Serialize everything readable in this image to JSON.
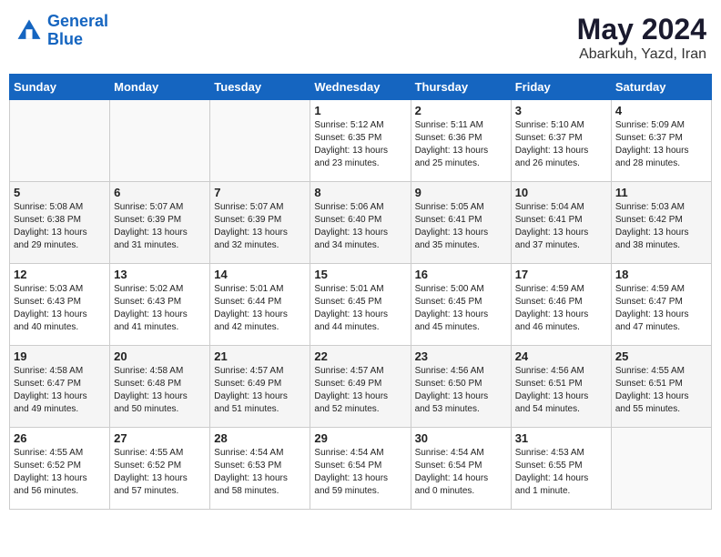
{
  "logo": {
    "line1": "General",
    "line2": "Blue"
  },
  "title": "May 2024",
  "subtitle": "Abarkuh, Yazd, Iran",
  "days_of_week": [
    "Sunday",
    "Monday",
    "Tuesday",
    "Wednesday",
    "Thursday",
    "Friday",
    "Saturday"
  ],
  "weeks": [
    [
      {
        "day": "",
        "info": ""
      },
      {
        "day": "",
        "info": ""
      },
      {
        "day": "",
        "info": ""
      },
      {
        "day": "1",
        "info": "Sunrise: 5:12 AM\nSunset: 6:35 PM\nDaylight: 13 hours\nand 23 minutes."
      },
      {
        "day": "2",
        "info": "Sunrise: 5:11 AM\nSunset: 6:36 PM\nDaylight: 13 hours\nand 25 minutes."
      },
      {
        "day": "3",
        "info": "Sunrise: 5:10 AM\nSunset: 6:37 PM\nDaylight: 13 hours\nand 26 minutes."
      },
      {
        "day": "4",
        "info": "Sunrise: 5:09 AM\nSunset: 6:37 PM\nDaylight: 13 hours\nand 28 minutes."
      }
    ],
    [
      {
        "day": "5",
        "info": "Sunrise: 5:08 AM\nSunset: 6:38 PM\nDaylight: 13 hours\nand 29 minutes."
      },
      {
        "day": "6",
        "info": "Sunrise: 5:07 AM\nSunset: 6:39 PM\nDaylight: 13 hours\nand 31 minutes."
      },
      {
        "day": "7",
        "info": "Sunrise: 5:07 AM\nSunset: 6:39 PM\nDaylight: 13 hours\nand 32 minutes."
      },
      {
        "day": "8",
        "info": "Sunrise: 5:06 AM\nSunset: 6:40 PM\nDaylight: 13 hours\nand 34 minutes."
      },
      {
        "day": "9",
        "info": "Sunrise: 5:05 AM\nSunset: 6:41 PM\nDaylight: 13 hours\nand 35 minutes."
      },
      {
        "day": "10",
        "info": "Sunrise: 5:04 AM\nSunset: 6:41 PM\nDaylight: 13 hours\nand 37 minutes."
      },
      {
        "day": "11",
        "info": "Sunrise: 5:03 AM\nSunset: 6:42 PM\nDaylight: 13 hours\nand 38 minutes."
      }
    ],
    [
      {
        "day": "12",
        "info": "Sunrise: 5:03 AM\nSunset: 6:43 PM\nDaylight: 13 hours\nand 40 minutes."
      },
      {
        "day": "13",
        "info": "Sunrise: 5:02 AM\nSunset: 6:43 PM\nDaylight: 13 hours\nand 41 minutes."
      },
      {
        "day": "14",
        "info": "Sunrise: 5:01 AM\nSunset: 6:44 PM\nDaylight: 13 hours\nand 42 minutes."
      },
      {
        "day": "15",
        "info": "Sunrise: 5:01 AM\nSunset: 6:45 PM\nDaylight: 13 hours\nand 44 minutes."
      },
      {
        "day": "16",
        "info": "Sunrise: 5:00 AM\nSunset: 6:45 PM\nDaylight: 13 hours\nand 45 minutes."
      },
      {
        "day": "17",
        "info": "Sunrise: 4:59 AM\nSunset: 6:46 PM\nDaylight: 13 hours\nand 46 minutes."
      },
      {
        "day": "18",
        "info": "Sunrise: 4:59 AM\nSunset: 6:47 PM\nDaylight: 13 hours\nand 47 minutes."
      }
    ],
    [
      {
        "day": "19",
        "info": "Sunrise: 4:58 AM\nSunset: 6:47 PM\nDaylight: 13 hours\nand 49 minutes."
      },
      {
        "day": "20",
        "info": "Sunrise: 4:58 AM\nSunset: 6:48 PM\nDaylight: 13 hours\nand 50 minutes."
      },
      {
        "day": "21",
        "info": "Sunrise: 4:57 AM\nSunset: 6:49 PM\nDaylight: 13 hours\nand 51 minutes."
      },
      {
        "day": "22",
        "info": "Sunrise: 4:57 AM\nSunset: 6:49 PM\nDaylight: 13 hours\nand 52 minutes."
      },
      {
        "day": "23",
        "info": "Sunrise: 4:56 AM\nSunset: 6:50 PM\nDaylight: 13 hours\nand 53 minutes."
      },
      {
        "day": "24",
        "info": "Sunrise: 4:56 AM\nSunset: 6:51 PM\nDaylight: 13 hours\nand 54 minutes."
      },
      {
        "day": "25",
        "info": "Sunrise: 4:55 AM\nSunset: 6:51 PM\nDaylight: 13 hours\nand 55 minutes."
      }
    ],
    [
      {
        "day": "26",
        "info": "Sunrise: 4:55 AM\nSunset: 6:52 PM\nDaylight: 13 hours\nand 56 minutes."
      },
      {
        "day": "27",
        "info": "Sunrise: 4:55 AM\nSunset: 6:52 PM\nDaylight: 13 hours\nand 57 minutes."
      },
      {
        "day": "28",
        "info": "Sunrise: 4:54 AM\nSunset: 6:53 PM\nDaylight: 13 hours\nand 58 minutes."
      },
      {
        "day": "29",
        "info": "Sunrise: 4:54 AM\nSunset: 6:54 PM\nDaylight: 13 hours\nand 59 minutes."
      },
      {
        "day": "30",
        "info": "Sunrise: 4:54 AM\nSunset: 6:54 PM\nDaylight: 14 hours\nand 0 minutes."
      },
      {
        "day": "31",
        "info": "Sunrise: 4:53 AM\nSunset: 6:55 PM\nDaylight: 14 hours\nand 1 minute."
      },
      {
        "day": "",
        "info": ""
      }
    ]
  ]
}
